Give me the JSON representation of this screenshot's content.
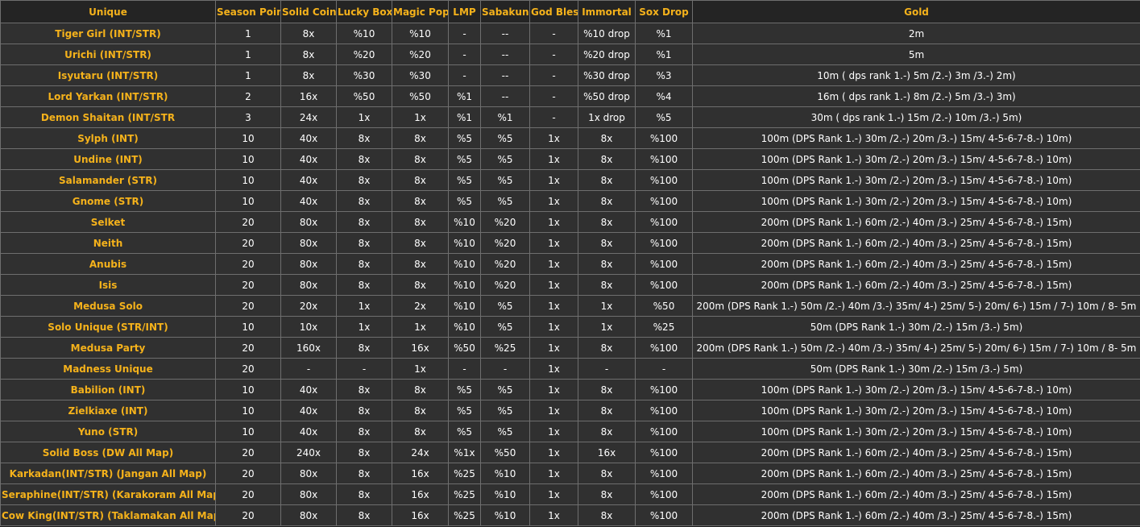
{
  "table": {
    "headers": [
      "Unique",
      "Season Point",
      "Solid Coin",
      "Lucky Box",
      "Magic Pop",
      "LMP",
      "Sabakun",
      "God Bless",
      "Immortal",
      "Sox Drop",
      "Gold"
    ],
    "rows": [
      [
        "Tiger Girl (INT/STR)",
        "1",
        "8x",
        "%10",
        "%10",
        "-",
        "--",
        "-",
        "%10 drop",
        "%1",
        "2m"
      ],
      [
        "Urichi (INT/STR)",
        "1",
        "8x",
        "%20",
        "%20",
        "-",
        "--",
        "-",
        "%20 drop",
        "%1",
        "5m"
      ],
      [
        "Isyutaru (INT/STR)",
        "1",
        "8x",
        "%30",
        "%30",
        "-",
        "--",
        "-",
        "%30 drop",
        "%3",
        "10m ( dps rank 1.-) 5m /2.-) 3m /3.-) 2m)"
      ],
      [
        "Lord Yarkan (INT/STR)",
        "2",
        "16x",
        "%50",
        "%50",
        "%1",
        "--",
        "-",
        "%50 drop",
        "%4",
        "16m ( dps rank 1.-) 8m /2.-) 5m /3.-) 3m)"
      ],
      [
        "Demon Shaitan (INT/STR",
        "3",
        "24x",
        "1x",
        "1x",
        "%1",
        "%1",
        "-",
        "1x drop",
        "%5",
        "30m ( dps rank 1.-) 15m /2.-) 10m /3.-) 5m)"
      ],
      [
        "Sylph (INT)",
        "10",
        "40x",
        "8x",
        "8x",
        "%5",
        "%5",
        "1x",
        "8x",
        "%100",
        "100m (DPS Rank 1.-) 30m /2.-) 20m /3.-) 15m/ 4-5-6-7-8.-) 10m)"
      ],
      [
        "Undine (INT)",
        "10",
        "40x",
        "8x",
        "8x",
        "%5",
        "%5",
        "1x",
        "8x",
        "%100",
        "100m (DPS Rank 1.-) 30m /2.-) 20m /3.-) 15m/ 4-5-6-7-8.-) 10m)"
      ],
      [
        "Salamander (STR)",
        "10",
        "40x",
        "8x",
        "8x",
        "%5",
        "%5",
        "1x",
        "8x",
        "%100",
        "100m (DPS Rank 1.-) 30m /2.-) 20m /3.-) 15m/ 4-5-6-7-8.-) 10m)"
      ],
      [
        "Gnome (STR)",
        "10",
        "40x",
        "8x",
        "8x",
        "%5",
        "%5",
        "1x",
        "8x",
        "%100",
        "100m (DPS Rank 1.-) 30m /2.-) 20m /3.-) 15m/ 4-5-6-7-8.-) 10m)"
      ],
      [
        "Selket",
        "20",
        "80x",
        "8x",
        "8x",
        "%10",
        "%20",
        "1x",
        "8x",
        "%100",
        "200m (DPS Rank 1.-) 60m /2.-) 40m /3.-) 25m/ 4-5-6-7-8.-) 15m)"
      ],
      [
        "Neith",
        "20",
        "80x",
        "8x",
        "8x",
        "%10",
        "%20",
        "1x",
        "8x",
        "%100",
        "200m (DPS Rank 1.-) 60m /2.-) 40m /3.-) 25m/ 4-5-6-7-8.-) 15m)"
      ],
      [
        "Anubis",
        "20",
        "80x",
        "8x",
        "8x",
        "%10",
        "%20",
        "1x",
        "8x",
        "%100",
        "200m (DPS Rank 1.-) 60m /2.-) 40m /3.-) 25m/ 4-5-6-7-8.-) 15m)"
      ],
      [
        "Isis",
        "20",
        "80x",
        "8x",
        "8x",
        "%10",
        "%20",
        "1x",
        "8x",
        "%100",
        "200m (DPS Rank 1.-) 60m /2.-) 40m /3.-) 25m/ 4-5-6-7-8.-) 15m)"
      ],
      [
        "Medusa Solo",
        "20",
        "20x",
        "1x",
        "2x",
        "%10",
        "%5",
        "1x",
        "1x",
        "%50",
        "200m (DPS Rank 1.-) 50m /2.-) 40m /3.-) 35m/ 4-) 25m/ 5-) 20m/ 6-) 15m / 7-) 10m / 8- 5m"
      ],
      [
        "Solo Unique (STR/INT)",
        "10",
        "10x",
        "1x",
        "1x",
        "%10",
        "%5",
        "1x",
        "1x",
        "%25",
        "50m (DPS Rank 1.-) 30m /2.-) 15m /3.-) 5m)"
      ],
      [
        "Medusa Party",
        "20",
        "160x",
        "8x",
        "16x",
        "%50",
        "%25",
        "1x",
        "8x",
        "%100",
        "200m (DPS Rank 1.-) 50m /2.-) 40m /3.-) 35m/ 4-) 25m/ 5-) 20m/ 6-) 15m / 7-) 10m / 8- 5m"
      ],
      [
        "Madness Unique",
        "20",
        "-",
        "-",
        "1x",
        "-",
        "-",
        "1x",
        "-",
        "-",
        "50m (DPS Rank 1.-) 30m /2.-) 15m /3.-) 5m)"
      ],
      [
        "Babilion (INT)",
        "10",
        "40x",
        "8x",
        "8x",
        "%5",
        "%5",
        "1x",
        "8x",
        "%100",
        "100m (DPS Rank 1.-) 30m /2.-) 20m /3.-) 15m/ 4-5-6-7-8.-) 10m)"
      ],
      [
        "Zielkiaxe (INT)",
        "10",
        "40x",
        "8x",
        "8x",
        "%5",
        "%5",
        "1x",
        "8x",
        "%100",
        "100m (DPS Rank 1.-) 30m /2.-) 20m /3.-) 15m/ 4-5-6-7-8.-) 10m)"
      ],
      [
        "Yuno (STR)",
        "10",
        "40x",
        "8x",
        "8x",
        "%5",
        "%5",
        "1x",
        "8x",
        "%100",
        "100m (DPS Rank 1.-) 30m /2.-) 20m /3.-) 15m/ 4-5-6-7-8.-) 10m)"
      ],
      [
        "Solid Boss (DW All Map)",
        "20",
        "240x",
        "8x",
        "24x",
        "%1x",
        "%50",
        "1x",
        "16x",
        "%100",
        "200m (DPS Rank 1.-) 60m /2.-) 40m /3.-) 25m/ 4-5-6-7-8.-) 15m)"
      ],
      [
        "Karkadan(INT/STR) (Jangan All Map)",
        "20",
        "80x",
        "8x",
        "16x",
        "%25",
        "%10",
        "1x",
        "8x",
        "%100",
        "200m (DPS Rank 1.-) 60m /2.-) 40m /3.-) 25m/ 4-5-6-7-8.-) 15m)"
      ],
      [
        "Seraphine(INT/STR) (Karakoram All Map)",
        "20",
        "80x",
        "8x",
        "16x",
        "%25",
        "%10",
        "1x",
        "8x",
        "%100",
        "200m (DPS Rank 1.-) 60m /2.-) 40m /3.-) 25m/ 4-5-6-7-8.-) 15m)"
      ],
      [
        "Cow King(INT/STR) (Taklamakan All Map)",
        "20",
        "80x",
        "8x",
        "16x",
        "%25",
        "%10",
        "1x",
        "8x",
        "%100",
        "200m (DPS Rank 1.-) 60m /2.-) 40m /3.-) 25m/ 4-5-6-7-8.-) 15m)"
      ]
    ]
  },
  "colors": {
    "header_text": "#f5b21b",
    "name_text": "#f5b21b",
    "cell_text": "#ffffff",
    "cell_background": "#303030",
    "header_background": "#242424",
    "grid_line": "#6e6e6e"
  }
}
